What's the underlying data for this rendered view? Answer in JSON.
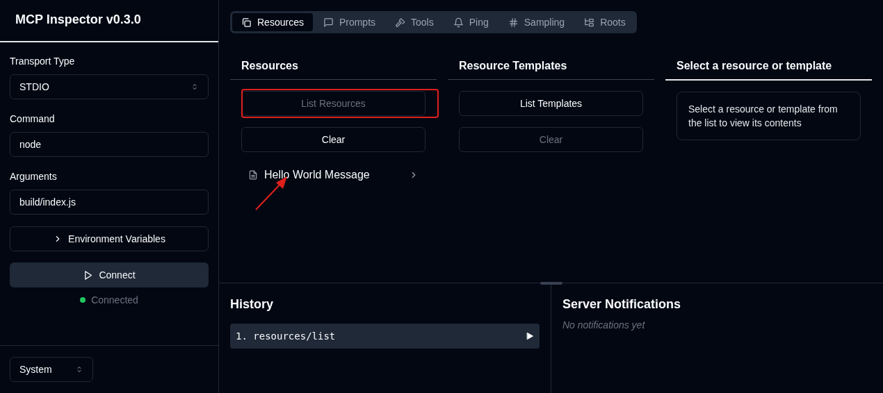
{
  "sidebar": {
    "title": "MCP Inspector v0.3.0",
    "fields": [
      {
        "kind": "select",
        "label": "Transport Type",
        "value": "STDIO"
      },
      {
        "kind": "input",
        "label": "Command",
        "value": "node"
      },
      {
        "kind": "input",
        "label": "Arguments",
        "value": "build/index.js"
      }
    ],
    "env_button": {
      "label": "Environment Variables",
      "expanded": false
    },
    "connect_button": "Connect",
    "status": {
      "text": "Connected",
      "color": "#22c55e"
    },
    "theme_select": "System"
  },
  "tabs": [
    {
      "label": "Resources",
      "kind": "resources",
      "selected": true
    },
    {
      "label": "Prompts",
      "kind": "prompts",
      "selected": false
    },
    {
      "label": "Tools",
      "kind": "tools",
      "selected": false
    },
    {
      "label": "Ping",
      "kind": "ping",
      "selected": false
    },
    {
      "label": "Sampling",
      "kind": "sampling",
      "selected": false
    },
    {
      "label": "Roots",
      "kind": "roots",
      "selected": false
    }
  ],
  "resources": {
    "title": "Resources",
    "buttons": [
      {
        "label": "List Resources",
        "disabled": true,
        "highlighted": true
      },
      {
        "label": "Clear",
        "disabled": false,
        "highlighted": false
      }
    ],
    "items": [
      {
        "name": "Hello World Message"
      }
    ]
  },
  "templates": {
    "title": "Resource Templates",
    "buttons": [
      {
        "label": "List Templates",
        "disabled": false,
        "highlighted": false
      },
      {
        "label": "Clear",
        "disabled": true,
        "highlighted": false
      }
    ]
  },
  "detail": {
    "title": "Select a resource or template",
    "message": "Select a resource or template from the list to view its contents"
  },
  "history": {
    "title": "History",
    "items": [
      {
        "number": "1.",
        "method": "resources/list",
        "expanded": false
      }
    ]
  },
  "notifications": {
    "title": "Server Notifications",
    "empty_text": "No notifications yet"
  }
}
